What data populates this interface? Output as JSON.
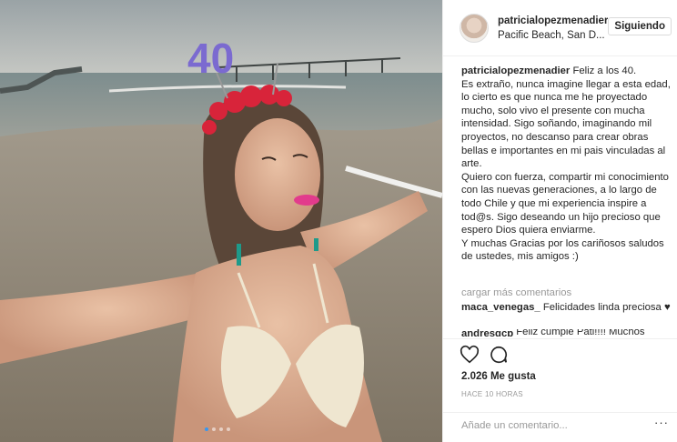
{
  "photo": {
    "description_icon": "beach-photo-image",
    "headband_text": "40",
    "carousel_dots": 4,
    "active_dot": 0
  },
  "header": {
    "username": "patricialopezmenadier",
    "location": "Pacific Beach, San D...",
    "follow_label": "Siguiendo"
  },
  "caption": {
    "username": "patricialopezmenadier",
    "paragraph1": "Feliz a los 40.",
    "paragraph2": "Es extraño, nunca imagine llegar a esta edad, lo cierto es que nunca me he proyectado mucho, solo vivo el presente con mucha intensidad. Sigo soñando, imaginando mil proyectos, no descanso para crear obras bellas e importantes en mi pais vinculadas al arte.",
    "paragraph3": "Quiero con fuerza, compartir mi conocimiento con las nuevas generaciones, a lo largo de todo Chile y que mi experiencia inspire a tod@s. Sigo deseando un hijo precioso que espero Dios quiera enviarme.",
    "paragraph4": "Y muchas Gracias por los cariñosos saludos de ustedes, mis amigos :)"
  },
  "comments": {
    "load_more": "cargar más comentarios",
    "items": [
      {
        "username": "maca_venegas_",
        "text": "Felicidades linda preciosa ♥"
      },
      {
        "username": "andresgcp",
        "text": "Feliz cumple Pati!!!! Muchos"
      }
    ]
  },
  "actions": {
    "likes": "2.026 Me gusta",
    "timestamp": "HACE 10 HORAS",
    "add_comment_placeholder": "Añade un comentario...",
    "more_glyph": "···"
  },
  "colors": {
    "accent": "#3897f0",
    "border": "#efefef",
    "muted": "#999999",
    "text": "#262626"
  }
}
